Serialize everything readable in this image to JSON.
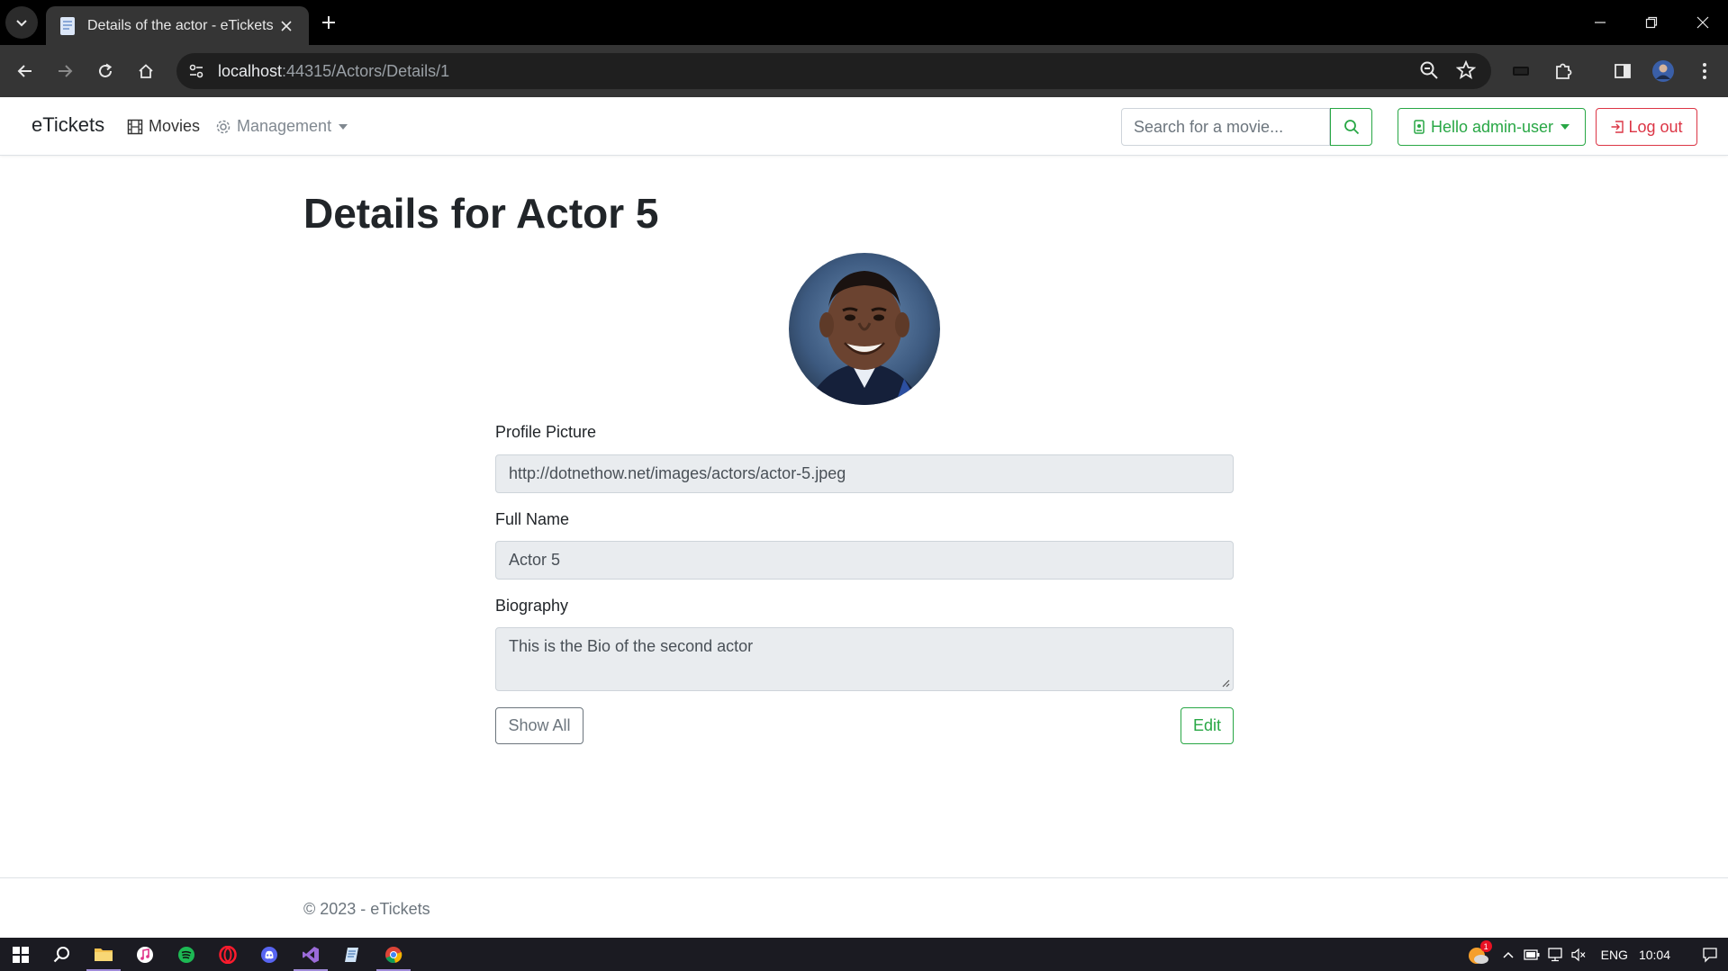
{
  "browser": {
    "tab_title": "Details of the actor - eTickets",
    "url_host": "localhost",
    "url_rest": ":44315/Actors/Details/1"
  },
  "navbar": {
    "brand": "eTickets",
    "movies_label": "Movies",
    "management_label": "Management",
    "search_placeholder": "Search for a movie...",
    "user_label": "Hello admin-user",
    "logout_label": "Log out"
  },
  "page": {
    "title": "Details for Actor 5",
    "profile_picture_label": "Profile Picture",
    "profile_picture_value": "http://dotnethow.net/images/actors/actor-5.jpeg",
    "full_name_label": "Full Name",
    "full_name_value": "Actor 5",
    "biography_label": "Biography",
    "biography_value": "This is the Bio of the second actor",
    "show_all_label": "Show All",
    "edit_label": "Edit"
  },
  "footer": {
    "text": "© 2023 - eTickets"
  },
  "taskbar": {
    "language": "ENG",
    "time": "10:04",
    "notification_count": "1"
  },
  "colors": {
    "success": "#28a745",
    "danger": "#dc3545",
    "secondary": "#6c757d",
    "readonly_bg": "#e9ecef"
  }
}
